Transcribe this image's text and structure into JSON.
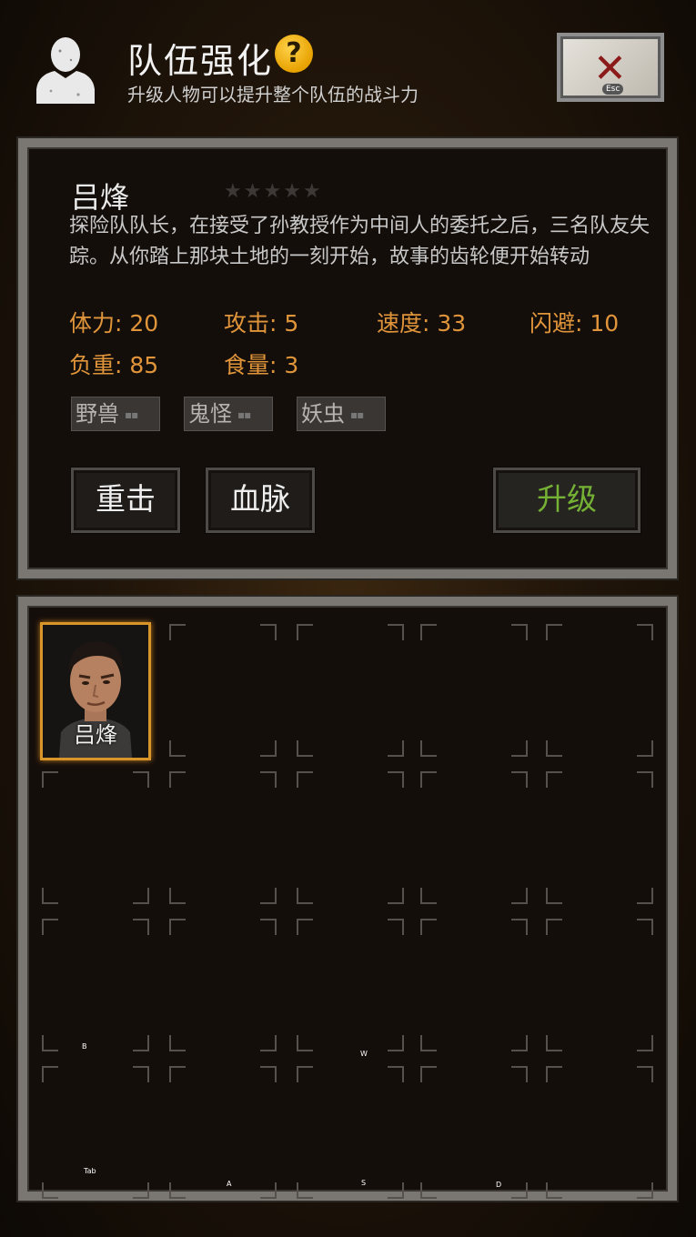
{
  "header": {
    "title": "队伍强化",
    "help_glyph": "?",
    "subtitle": "升级人物可以提升整个队伍的战斗力",
    "close_glyph": "✕",
    "close_key": "Esc"
  },
  "character": {
    "name": "吕烽",
    "stars_glyph": "★★★★★",
    "stars_filled": 0,
    "stars_total": 5,
    "description": "探险队队长，在接受了孙教授作为中间人的委托之后，三名队友失踪。从你踏上那块土地的一刻开始，故事的齿轮便开始转动",
    "stats": {
      "hp": "体力: 20",
      "attack": "攻击: 5",
      "speed": "速度: 33",
      "dodge": "闪避: 10",
      "load": "负重: 85",
      "food": "食量: 3"
    },
    "tags": [
      {
        "label": "野兽",
        "level": "▪▪"
      },
      {
        "label": "鬼怪",
        "level": "▪▪"
      },
      {
        "label": "妖虫",
        "level": "▪▪"
      }
    ]
  },
  "actions": {
    "heavy_strike": "重击",
    "bloodline": "血脉",
    "upgrade": "升级"
  },
  "roster": {
    "selected_name": "吕烽"
  },
  "key_hints": {
    "b": "B",
    "w": "W",
    "tab": "Tab",
    "a": "A",
    "s": "S",
    "d": "D"
  },
  "colors": {
    "stat_orange": "#e0953a",
    "upgrade_green": "#74b134",
    "selected_border": "#d8952a"
  }
}
